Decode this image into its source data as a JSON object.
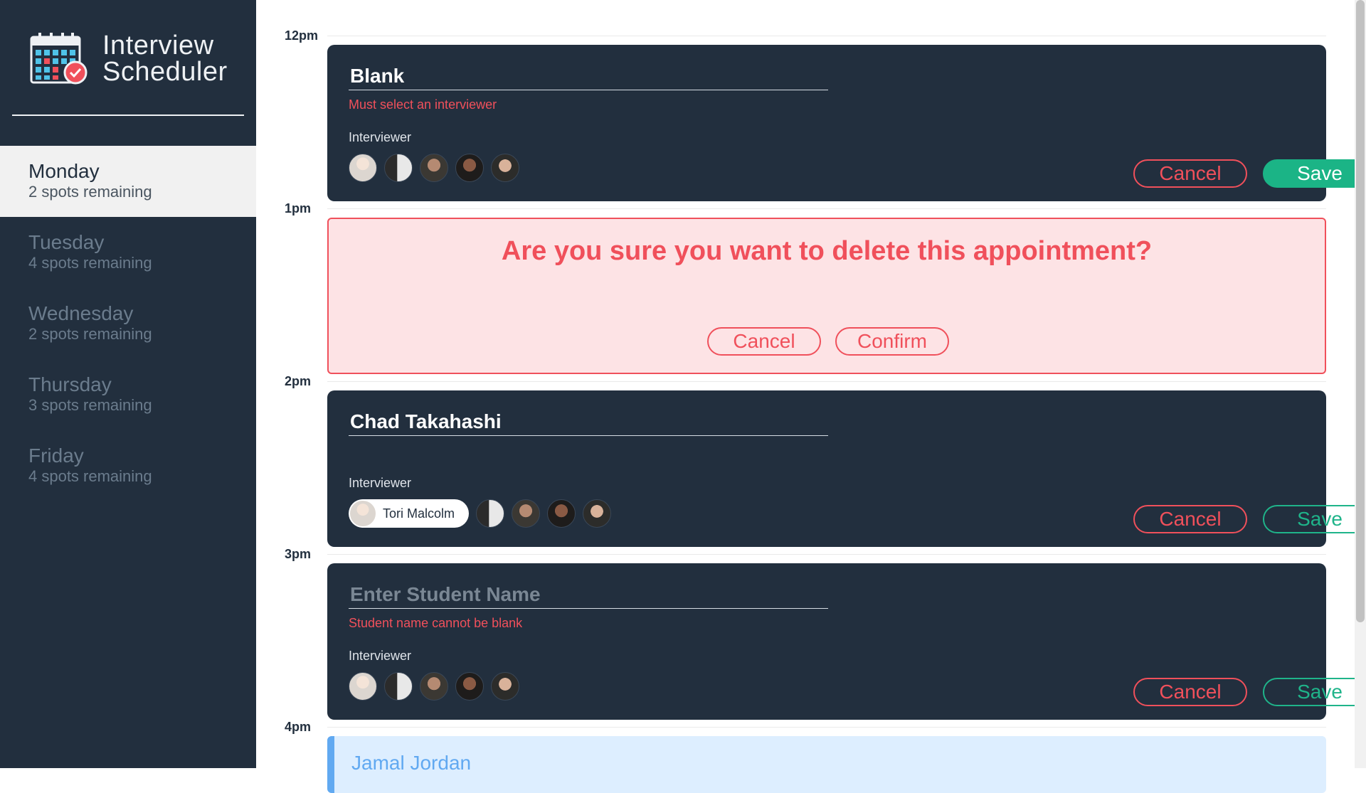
{
  "app": {
    "title_line1": "Interview",
    "title_line2": "Scheduler",
    "logo_icon": "calendar-check-icon"
  },
  "days": [
    {
      "name": "Monday",
      "spots": "2 spots remaining",
      "selected": true
    },
    {
      "name": "Tuesday",
      "spots": "4 spots remaining",
      "selected": false
    },
    {
      "name": "Wednesday",
      "spots": "2 spots remaining",
      "selected": false
    },
    {
      "name": "Thursday",
      "spots": "3 spots remaining",
      "selected": false
    },
    {
      "name": "Friday",
      "spots": "4 spots remaining",
      "selected": false
    }
  ],
  "slots": [
    {
      "time": "12pm",
      "mode": "edit",
      "student_value": "Blank",
      "student_placeholder": "Enter Student Name",
      "error": "Must select an interviewer",
      "interviewer_label": "Interviewer",
      "cancel_label": "Cancel",
      "save_label": "Save"
    },
    {
      "time": "1pm",
      "mode": "confirm",
      "message": "Are you sure you want to delete this appointment?",
      "cancel_label": "Cancel",
      "confirm_label": "Confirm"
    },
    {
      "time": "2pm",
      "mode": "edit",
      "student_value": "Chad Takahashi",
      "student_placeholder": "Enter Student Name",
      "interviewer_label": "Interviewer",
      "selected_interviewer": "Tori Malcolm",
      "cancel_label": "Cancel",
      "save_label": "Save"
    },
    {
      "time": "3pm",
      "mode": "edit",
      "student_value": "",
      "student_placeholder": "Enter Student Name",
      "error": "Student name cannot be blank",
      "interviewer_label": "Interviewer",
      "cancel_label": "Cancel",
      "save_label": "Save"
    },
    {
      "time": "4pm",
      "mode": "show",
      "student_value": "Jamal Jordan"
    }
  ],
  "colors": {
    "sidebar_bg": "#222f3e",
    "error_red": "#f0505b",
    "save_green": "#1bb486",
    "confirm_bg": "#fde3e5",
    "show_blue": "#61a9f1"
  }
}
